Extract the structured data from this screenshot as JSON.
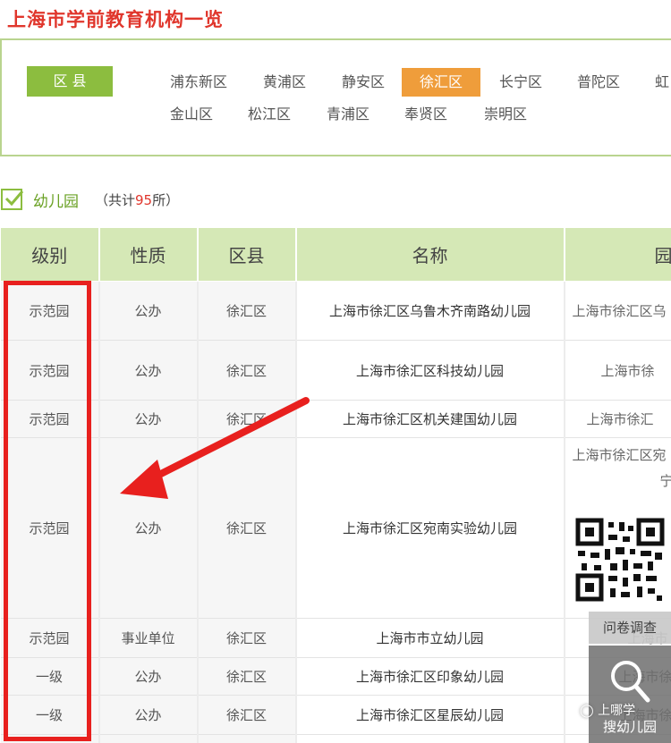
{
  "page": {
    "title": "上海市学前教育机构一览"
  },
  "filter": {
    "label": "区 县",
    "row1": [
      "浦东新区",
      "黄浦区",
      "静安区",
      "徐汇区",
      "长宁区",
      "普陀区",
      "虹口区"
    ],
    "row2": [
      "金山区",
      "松江区",
      "青浦区",
      "奉贤区",
      "崇明区"
    ],
    "selected": "徐汇区"
  },
  "section": {
    "name": "幼儿园",
    "count_prefix": "（共计",
    "count": "95",
    "count_suffix": "所）"
  },
  "table": {
    "headers": [
      "级别",
      "性质",
      "区县",
      "名称",
      "园"
    ],
    "rows": [
      {
        "level": "示范园",
        "type": "公办",
        "district": "徐汇区",
        "name": "上海市徐汇区乌鲁木齐南路幼儿园",
        "address": "上海市徐汇区乌"
      },
      {
        "level": "示范园",
        "type": "公办",
        "district": "徐汇区",
        "name": "上海市徐汇区科技幼儿园",
        "address": "上海市徐"
      },
      {
        "level": "示范园",
        "type": "公办",
        "district": "徐汇区",
        "name": "上海市徐汇区机关建国幼儿园",
        "address": "上海市徐汇"
      },
      {
        "level": "示范园",
        "type": "公办",
        "district": "徐汇区",
        "name": "上海市徐汇区宛南实验幼儿园",
        "address": "上海市徐汇区宛",
        "address2": "宁"
      },
      {
        "level": "示范园",
        "type": "事业单位",
        "district": "徐汇区",
        "name": "上海市市立幼儿园",
        "address": "上海市"
      },
      {
        "level": "一级",
        "type": "公办",
        "district": "徐汇区",
        "name": "上海市徐汇区印象幼儿园",
        "address": "上海市徐汇区"
      },
      {
        "level": "一级",
        "type": "公办",
        "district": "徐汇区",
        "name": "上海市徐汇区星辰幼儿园",
        "address": "上海市徐汇区"
      }
    ]
  },
  "widgets": {
    "survey": "问卷调查",
    "search": "搜幼儿园",
    "watermark": "上哪学"
  },
  "colors": {
    "accent_green": "#8cbd3f",
    "selected_orange": "#ef9d3b",
    "title_red": "#e0362c",
    "highlight_red": "#e8201e"
  }
}
